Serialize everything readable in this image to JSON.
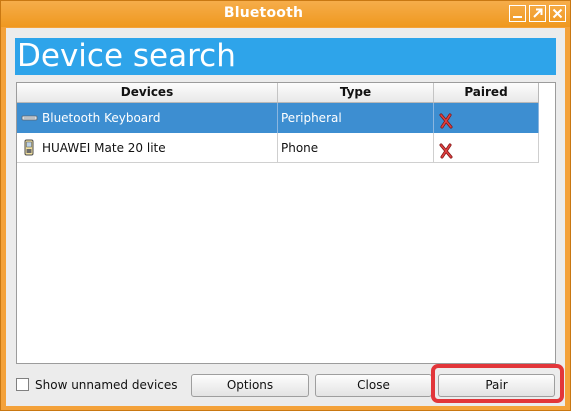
{
  "window": {
    "title": "Bluetooth",
    "controls": [
      "minimize-icon",
      "maximize-icon",
      "close-icon"
    ]
  },
  "banner": {
    "text": "Device search"
  },
  "table": {
    "columns": [
      "Devices",
      "Type",
      "Paired"
    ],
    "rows": [
      {
        "icon": "keyboard-icon",
        "device": "Bluetooth Keyboard",
        "type": "Peripheral",
        "paired_icon": "x-mark-icon",
        "selected": true
      },
      {
        "icon": "phone-icon",
        "device": "HUAWEI Mate 20 lite",
        "type": "Phone",
        "paired_icon": "x-mark-icon",
        "selected": false
      }
    ]
  },
  "footer": {
    "checkbox_label": "Show unnamed devices",
    "checkbox_checked": false,
    "options_label": "Options",
    "close_label": "Close",
    "pair_label": "Pair"
  },
  "colors": {
    "titlebar": "#f4a23a",
    "banner": "#2ea4ea",
    "selection": "#3d8ed1",
    "highlight": "#e2363a"
  }
}
